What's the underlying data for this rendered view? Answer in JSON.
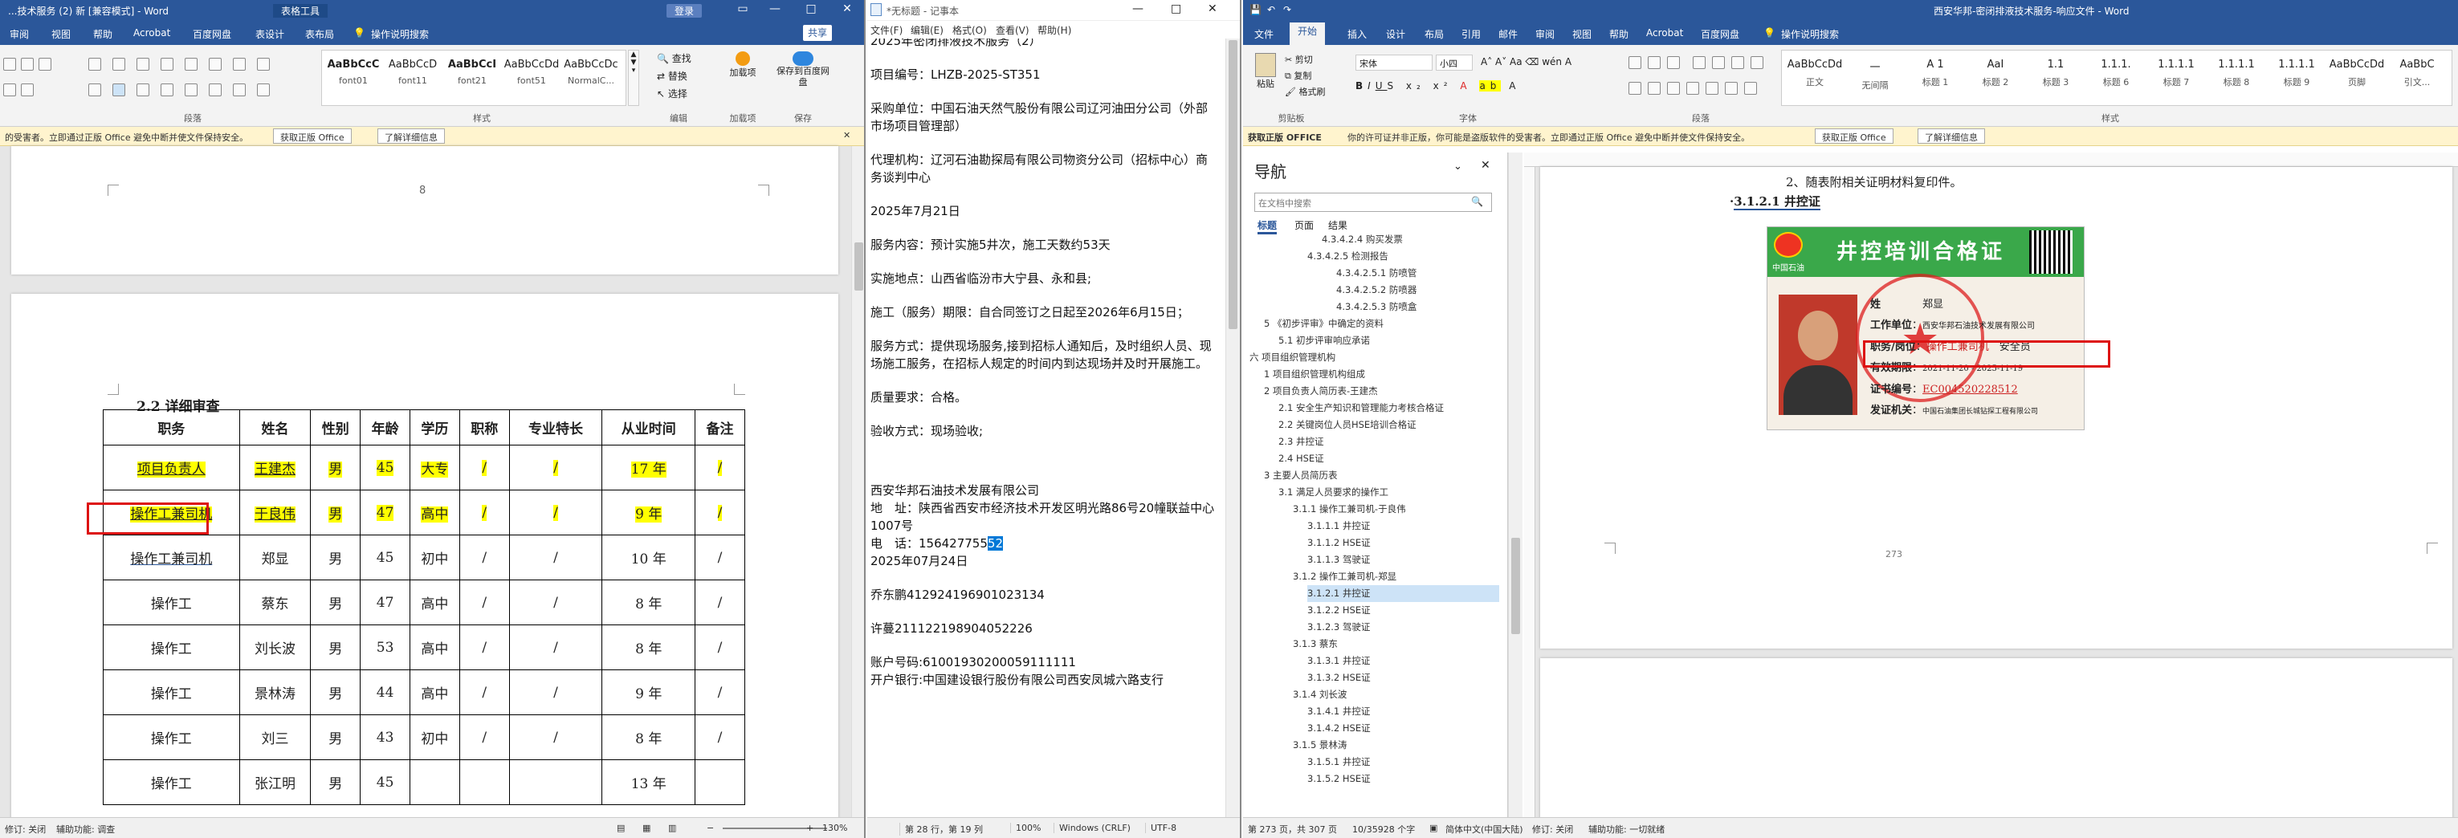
{
  "win1": {
    "title": "...技术服务 (2) 新 [兼容模式] - Word",
    "context_tab": "表格工具",
    "login": "登录",
    "menu": [
      "审阅",
      "视图",
      "帮助",
      "Acrobat",
      "百度网盘",
      "表设计",
      "表布局",
      "操作说明搜索"
    ],
    "share": "共享",
    "ribbon": {
      "groups": [
        "段落",
        "样式",
        "编辑",
        "加载项",
        "保存"
      ],
      "styles": [
        {
          "preview": "AaBbCcC",
          "label": "font01"
        },
        {
          "preview": "AaBbCcD",
          "label": "font11"
        },
        {
          "preview": "AaBbCcI",
          "label": "font21"
        },
        {
          "preview": "AaBbCcDd",
          "label": "font51"
        },
        {
          "preview": "AaBbCcDc",
          "label": "NormalC..."
        }
      ],
      "find": "查找",
      "replace": "替换",
      "select": "选择",
      "addin_label": "加载项",
      "baidu_label": "保存到百度网盘",
      "addin_group_icon": "加载项"
    },
    "notice": {
      "text": "的受害者。立即通过正版 Office 避免中断并使文件保持安全。",
      "btn1": "获取正版 Office",
      "btn2": "了解详细信息"
    },
    "page_number": "8",
    "section_title": "2.2 详细审查",
    "table": {
      "headers": [
        "职务",
        "姓名",
        "性别",
        "年龄",
        "学历",
        "职称",
        "专业特长",
        "从业时间",
        "备注"
      ],
      "rows": [
        [
          "项目负责人",
          "王建杰",
          "男",
          "45",
          "大专",
          "/",
          "/",
          "17 年",
          "/"
        ],
        [
          "操作工兼司机",
          "于良伟",
          "男",
          "47",
          "高中",
          "/",
          "/",
          "9 年",
          "/"
        ],
        [
          "操作工兼司机",
          "郑显",
          "男",
          "45",
          "初中",
          "/",
          "/",
          "10 年",
          "/"
        ],
        [
          "操作工",
          "蔡东",
          "男",
          "47",
          "高中",
          "/",
          "/",
          "8 年",
          "/"
        ],
        [
          "操作工",
          "刘长波",
          "男",
          "53",
          "高中",
          "/",
          "/",
          "8 年",
          "/"
        ],
        [
          "操作工",
          "景林涛",
          "男",
          "44",
          "高中",
          "/",
          "/",
          "9 年",
          "/"
        ],
        [
          "操作工",
          "刘三",
          "男",
          "43",
          "初中",
          "/",
          "/",
          "8 年",
          "/"
        ],
        [
          "操作工",
          "张江明",
          "男",
          "45",
          "",
          "",
          "",
          "13 年",
          ""
        ]
      ]
    },
    "status": {
      "track": "修订: 关闭",
      "access": "辅助功能: 调查",
      "zoom": "130%"
    }
  },
  "win2": {
    "title": "*无标题 - 记事本",
    "menu": [
      "文件(F)",
      "编辑(E)",
      "格式(O)",
      "查看(V)",
      "帮助(H)"
    ],
    "lines": [
      "2025年密闭排液技术服务（2）",
      "项目编号：LHZB-2025-ST351",
      "采购单位：中国石油天然气股份有限公司辽河油田分公司（外部市场项目管理部）",
      "代理机构：辽河石油勘探局有限公司物资分公司（招标中心）商务谈判中心",
      "2025年7月21日",
      "服务内容：预计实施5井次，施工天数约53天",
      "实施地点：山西省临汾市大宁县、永和县;",
      "施工（服务）期限：自合同签订之日起至2026年6月15日；",
      "服务方式：提供现场服务,接到招标人通知后，及时组织人员、现场施工服务，在招标人规定的时间内到达现场并及时开展施工。",
      "质量要求：合格。",
      "验收方式：现场验收;"
    ],
    "company": "西安华邦石油技术发展有限公司",
    "address": "地　址：陕西省西安市经济技术开发区明光路86号20幢联益中心1007号",
    "phone_prefix": "电　话：156427755",
    "phone_selected": "52",
    "date2": "2025年07月24日",
    "id1": "乔东鹏412924196901023134",
    "id2": "许蔓211122198904052226",
    "account": "账户号码:61001930200059111111",
    "bank": "开户银行:中国建设银行股份有限公司西安凤城六路支行",
    "status": {
      "pos": "第 28 行，第 19 列",
      "zoom": "100%",
      "eol": "Windows (CRLF)",
      "enc": "UTF-8"
    }
  },
  "win3": {
    "title": "西安华邦-密闭排液技术服务-响应文件 - Word",
    "menu": [
      "文件",
      "开始",
      "插入",
      "设计",
      "布局",
      "引用",
      "邮件",
      "审阅",
      "视图",
      "帮助",
      "Acrobat",
      "百度网盘",
      "操作说明搜索"
    ],
    "active_tab": "开始",
    "ribbon": {
      "paste": "粘贴",
      "cut": "剪切",
      "copy": "复制",
      "format_painter": "格式刷",
      "font": "宋体",
      "size": "小四",
      "groups": [
        "剪贴板",
        "字体",
        "段落",
        "样式"
      ],
      "styles": [
        {
          "preview": "AaBbCcDd",
          "label": "正文"
        },
        {
          "preview": "一",
          "label": "无间隔"
        },
        {
          "preview": "A 1",
          "label": "标题 1"
        },
        {
          "preview": "AaI",
          "label": "标题 2"
        },
        {
          "preview": "1.1",
          "label": "标题 3"
        },
        {
          "preview": "1.1.1.",
          "label": "标题 6"
        },
        {
          "preview": "1.1.1.1",
          "label": "标题 7"
        },
        {
          "preview": "1.1.1.1",
          "label": "标题 8"
        },
        {
          "preview": "1.1.1.1",
          "label": "标题 9"
        },
        {
          "preview": "AaBbCcDd",
          "label": "页脚"
        },
        {
          "preview": "AaBbC",
          "label": "引文..."
        }
      ]
    },
    "notice": {
      "label": "获取正版 OFFICE",
      "text": "你的许可证并非正版，你可能是盗版软件的受害者。立即通过正版 Office 避免中断并使文件保持安全。",
      "btn1": "获取正版 Office",
      "btn2": "了解详细信息"
    },
    "nav": {
      "title": "导航",
      "search": "在文档中搜索",
      "tabs": [
        "标题",
        "页面",
        "结果"
      ],
      "items": [
        {
          "t": "4.3.4.2.4 购买发票",
          "l": 5
        },
        {
          "t": "4.3.4.2.5 检测报告",
          "l": 4
        },
        {
          "t": "4.3.4.2.5.1 防喷管",
          "l": 6
        },
        {
          "t": "4.3.4.2.5.2 防喷器",
          "l": 6
        },
        {
          "t": "4.3.4.2.5.3 防喷盒",
          "l": 6
        },
        {
          "t": "5 《初步评审》中确定的资料",
          "l": 1
        },
        {
          "t": "5.1 初步评审响应承诺",
          "l": 2
        },
        {
          "t": "六 项目组织管理机构",
          "l": 0
        },
        {
          "t": "1 项目组织管理机构组成",
          "l": 1
        },
        {
          "t": "2 项目负责人简历表-王建杰",
          "l": 1
        },
        {
          "t": "2.1 安全生产知识和管理能力考核合格证",
          "l": 2
        },
        {
          "t": "2.2 关键岗位人员HSE培训合格证",
          "l": 2
        },
        {
          "t": "2.3 井控证",
          "l": 2
        },
        {
          "t": "2.4 HSE证",
          "l": 2
        },
        {
          "t": "3 主要人员简历表",
          "l": 1
        },
        {
          "t": "3.1 满足人员要求的操作工",
          "l": 2
        },
        {
          "t": "3.1.1 操作工兼司机-于良伟",
          "l": 3
        },
        {
          "t": "3.1.1.1 井控证",
          "l": 4
        },
        {
          "t": "3.1.1.2 HSE证",
          "l": 4
        },
        {
          "t": "3.1.1.3 驾驶证",
          "l": 4
        },
        {
          "t": "3.1.2 操作工兼司机-郑显",
          "l": 3
        },
        {
          "t": "3.1.2.1 井控证",
          "l": 4,
          "sel": true
        },
        {
          "t": "3.1.2.2 HSE证",
          "l": 4
        },
        {
          "t": "3.1.2.3 驾驶证",
          "l": 4
        },
        {
          "t": "3.1.3 蔡东",
          "l": 3
        },
        {
          "t": "3.1.3.1 井控证",
          "l": 4
        },
        {
          "t": "3.1.3.2 HSE证",
          "l": 4
        },
        {
          "t": "3.1.4 刘长波",
          "l": 3
        },
        {
          "t": "3.1.4.1 井控证",
          "l": 4
        },
        {
          "t": "3.1.4.2 HSE证",
          "l": 4
        },
        {
          "t": "3.1.5 景林涛",
          "l": 3
        },
        {
          "t": "3.1.5.1 井控证",
          "l": 4
        },
        {
          "t": "3.1.5.2 HSE证",
          "l": 4
        }
      ]
    },
    "doc": {
      "line1": "2、随表附相关证明材料复印件。",
      "heading": "3.1.2.1 井控证",
      "cert": {
        "title": "井控培训合格证",
        "company": "中国石油",
        "name_label": "姓",
        "name_value": "郑显",
        "work_unit_label": "工作单位",
        "work_unit": "西安华邦石油技术发展有限公司",
        "post_label": "职务/岗位",
        "post": "操作工兼司机",
        "post_type": "安全员",
        "valid_label": "有效期限",
        "valid": "2021-11-20 - 2025-11-19",
        "no_label": "证书编号",
        "no": "EC004520228512",
        "issuer_label": "发证机关",
        "issuer": "中国石油集团长城钻探工程有限公司"
      },
      "page_num": "273"
    },
    "status": {
      "page": "第 273 页，共 307 页",
      "words": "10/35928 个字",
      "lang": "简体中文(中国大陆)",
      "track": "修订: 关闭",
      "access": "辅助功能: 一切就绪"
    }
  }
}
